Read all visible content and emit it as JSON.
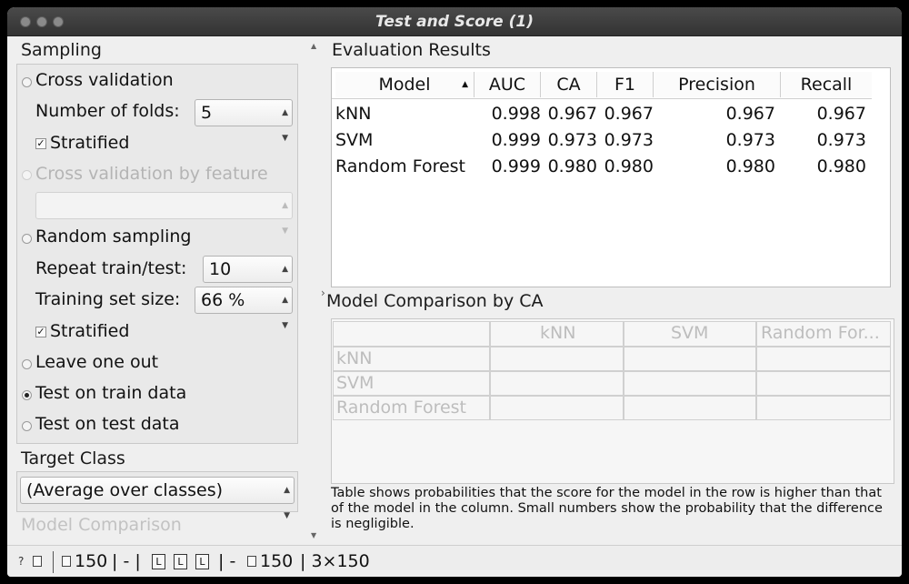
{
  "window": {
    "title": "Test and Score (1)"
  },
  "sampling": {
    "title": "Sampling",
    "cross_validation": "Cross validation",
    "folds_label": "Number of folds:",
    "folds_value": "5",
    "stratified": "Stratified",
    "cv_by_feature": "Cross validation by feature",
    "cv_by_feature_value": "",
    "random_sampling": "Random sampling",
    "repeat_label": "Repeat train/test:",
    "repeat_value": "10",
    "train_size_label": "Training set size:",
    "train_size_value": "66 %",
    "stratified2": "Stratified",
    "leave_one_out": "Leave one out",
    "test_on_train": "Test on train data",
    "test_on_test": "Test on test data",
    "selected": "Test on train data"
  },
  "target_class": {
    "title": "Target Class",
    "value": "(Average over classes)"
  },
  "model_comparison_left": {
    "title": "Model Comparison"
  },
  "evaluation": {
    "title": "Evaluation Results",
    "columns": [
      "Model",
      "AUC",
      "CA",
      "F1",
      "Precision",
      "Recall"
    ],
    "rows": [
      [
        "kNN",
        "0.998",
        "0.967",
        "0.967",
        "0.967",
        "0.967"
      ],
      [
        "SVM",
        "0.999",
        "0.973",
        "0.973",
        "0.973",
        "0.973"
      ],
      [
        "Random Forest",
        "0.999",
        "0.980",
        "0.980",
        "0.980",
        "0.980"
      ]
    ]
  },
  "comparison": {
    "title": "Model Comparison by CA",
    "columns": [
      "kNN",
      "SVM",
      "Random For..."
    ],
    "rows": [
      "kNN",
      "SVM",
      "Random Forest"
    ],
    "note": "Table shows probabilities that the score for the model in the row is higher than that of the model in the column. Small numbers show the probability that the difference is negligible."
  },
  "statusbar": {
    "help_icon": "?",
    "input_count": "150",
    "sep1": "| - |",
    "sq1": "L",
    "sq2": "L",
    "sq3": "L",
    "sep2": "| -",
    "output_count": "150",
    "shape": "| 3×150"
  },
  "icons": {
    "help": "help-icon",
    "report": "report-icon",
    "input": "input-icon",
    "output": "output-icon"
  }
}
